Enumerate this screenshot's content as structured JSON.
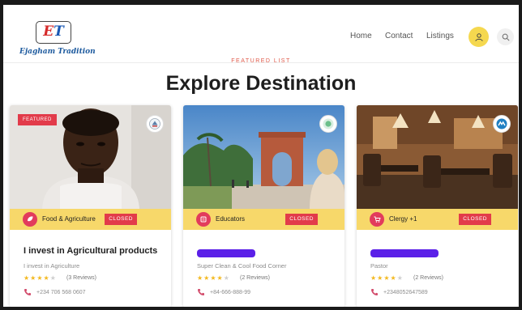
{
  "brand": {
    "logo_mark_left": "E",
    "logo_mark_right": "T",
    "logo_text": "Ejagham Tradition"
  },
  "nav": {
    "home": "Home",
    "contact": "Contact",
    "listings": "Listings"
  },
  "section": {
    "kicker": "FEATURED LIST",
    "title": "Explore Destination"
  },
  "cards": [
    {
      "featured": "FEATURED",
      "category": "Food & Agriculture",
      "status": "CLOSED",
      "title": "I invest in Agricultural products",
      "subtitle": "I invest in Agriculture",
      "rating": 4,
      "reviews": "(3 Reviews)",
      "phone": "+234 706 568 0607"
    },
    {
      "category": "Educators",
      "status": "CLOSED",
      "title_redacted": true,
      "subtitle": "Super Clean & Cool Food Corner",
      "rating": 4,
      "reviews": "(2 Reviews)",
      "phone": "+84-666-888-99"
    },
    {
      "category": "Clergy +1",
      "status": "CLOSED",
      "title_redacted": true,
      "subtitle": "Pastor",
      "rating": 4,
      "reviews": "(2 Reviews)",
      "phone": "+2348052647589"
    }
  ],
  "colors": {
    "accent_yellow": "#f7d86a",
    "closed_red": "#e23b4a",
    "category_pink": "#e23b5c",
    "star": "#f3b81f",
    "redaction": "#5b20e8"
  },
  "icons": {
    "user": "user-icon",
    "search": "search-icon",
    "phone": "phone-icon"
  }
}
